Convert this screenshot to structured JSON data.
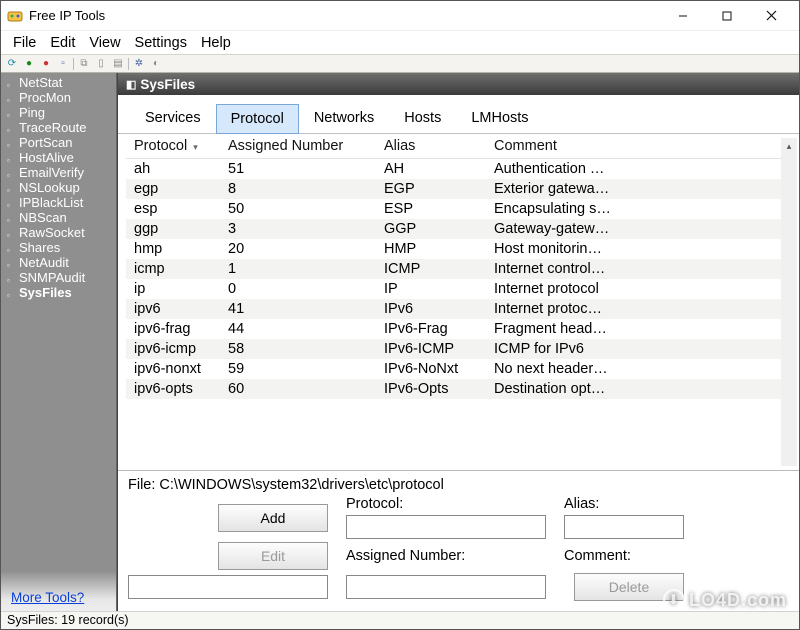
{
  "window": {
    "title": "Free IP Tools"
  },
  "menubar": [
    "File",
    "Edit",
    "View",
    "Settings",
    "Help"
  ],
  "sidebar": {
    "items": [
      {
        "label": "NetStat"
      },
      {
        "label": "ProcMon"
      },
      {
        "label": "Ping"
      },
      {
        "label": "TraceRoute"
      },
      {
        "label": "PortScan"
      },
      {
        "label": "HostAlive"
      },
      {
        "label": "EmailVerify"
      },
      {
        "label": "NSLookup"
      },
      {
        "label": "IPBlackList"
      },
      {
        "label": "NBScan"
      },
      {
        "label": "RawSocket"
      },
      {
        "label": "Shares"
      },
      {
        "label": "NetAudit"
      },
      {
        "label": "SNMPAudit"
      },
      {
        "label": "SysFiles"
      }
    ],
    "active_index": 14,
    "more_link": "More Tools?"
  },
  "panel": {
    "title": "SysFiles",
    "tabs": [
      "Services",
      "Protocol",
      "Networks",
      "Hosts",
      "LMHosts"
    ],
    "active_tab": 1,
    "columns": [
      "Protocol",
      "Assigned Number",
      "Alias",
      "Comment"
    ],
    "rows": [
      {
        "protocol": "ah",
        "num": "51",
        "alias": "AH",
        "comment": "Authentication …"
      },
      {
        "protocol": "egp",
        "num": "8",
        "alias": "EGP",
        "comment": "Exterior gatewa…"
      },
      {
        "protocol": "esp",
        "num": "50",
        "alias": "ESP",
        "comment": "Encapsulating s…"
      },
      {
        "protocol": "ggp",
        "num": "3",
        "alias": "GGP",
        "comment": "Gateway-gatew…"
      },
      {
        "protocol": "hmp",
        "num": "20",
        "alias": "HMP",
        "comment": "Host monitorin…"
      },
      {
        "protocol": "icmp",
        "num": "1",
        "alias": "ICMP",
        "comment": "Internet control…"
      },
      {
        "protocol": "ip",
        "num": "0",
        "alias": "IP",
        "comment": "Internet protocol"
      },
      {
        "protocol": "ipv6",
        "num": "41",
        "alias": "IPv6",
        "comment": "Internet protoc…"
      },
      {
        "protocol": "ipv6-frag",
        "num": "44",
        "alias": "IPv6-Frag",
        "comment": "Fragment head…"
      },
      {
        "protocol": "ipv6-icmp",
        "num": "58",
        "alias": "IPv6-ICMP",
        "comment": "ICMP for IPv6"
      },
      {
        "protocol": "ipv6-nonxt",
        "num": "59",
        "alias": "IPv6-NoNxt",
        "comment": "No next header…"
      },
      {
        "protocol": "ipv6-opts",
        "num": "60",
        "alias": "IPv6-Opts",
        "comment": "Destination opt…"
      }
    ]
  },
  "editor": {
    "file_label": "File: C:\\WINDOWS\\system32\\drivers\\etc\\protocol",
    "labels": {
      "protocol": "Protocol:",
      "alias": "Alias:",
      "assigned": "Assigned Number:",
      "comment": "Comment:"
    },
    "buttons": {
      "add": "Add",
      "edit": "Edit",
      "delete": "Delete"
    }
  },
  "status": "SysFiles: 19 record(s)",
  "watermark": "LO4D.com"
}
